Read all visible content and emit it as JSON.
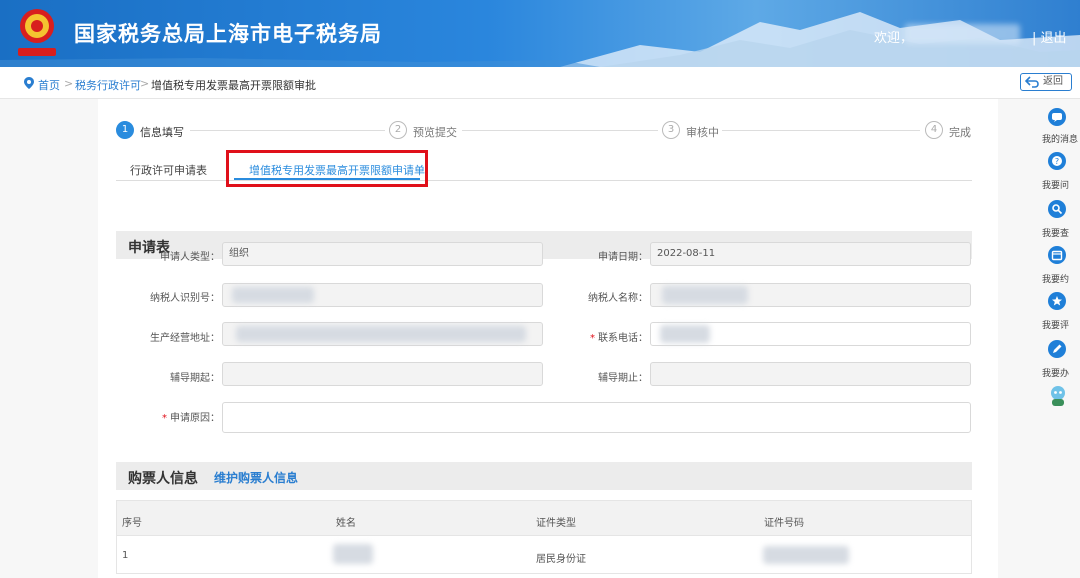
{
  "header": {
    "title": "国家税务总局上海市电子税务局",
    "welcome": "欢迎，",
    "logout": "| 退出"
  },
  "breadcrumb": {
    "home": "首页",
    "sep": ">",
    "level1": "税务行政许可",
    "current": "增值税专用发票最高开票限额审批",
    "back": "返回"
  },
  "steps": [
    {
      "num": "1",
      "label": "信息填写"
    },
    {
      "num": "2",
      "label": "预览提交"
    },
    {
      "num": "3",
      "label": "审核中"
    },
    {
      "num": "4",
      "label": "完成"
    }
  ],
  "tabs": {
    "tab1": "行政许可申请表",
    "tab2": "增值税专用发票最高开票限额申请单"
  },
  "application": {
    "section_title": "申请表",
    "applicant_type_label": "申请人类型：",
    "applicant_type_value": "组织",
    "apply_date_label": "申请日期：",
    "apply_date_value": "2022-08-11",
    "taxpayer_id_label": "纳税人识别号：",
    "taxpayer_name_label": "纳税人名称：",
    "address_label": "生产经营地址：",
    "phone_label": "联系电话：",
    "guide_start_label": "辅导期起：",
    "guide_end_label": "辅导期止：",
    "reason_label": "申请原因：",
    "required_mark": "*"
  },
  "buyer": {
    "section_title": "购票人信息",
    "maintain_link": "维护购票人信息",
    "columns": [
      "序号",
      "姓名",
      "证件类型",
      "证件号码"
    ],
    "rows": [
      {
        "no": "1",
        "id_type": "居民身份证"
      }
    ]
  },
  "sidebar": {
    "items": [
      "我的消息",
      "我要问",
      "我要查",
      "我要约",
      "我要评",
      "我要办"
    ],
    "mascot": "税务小助手"
  }
}
